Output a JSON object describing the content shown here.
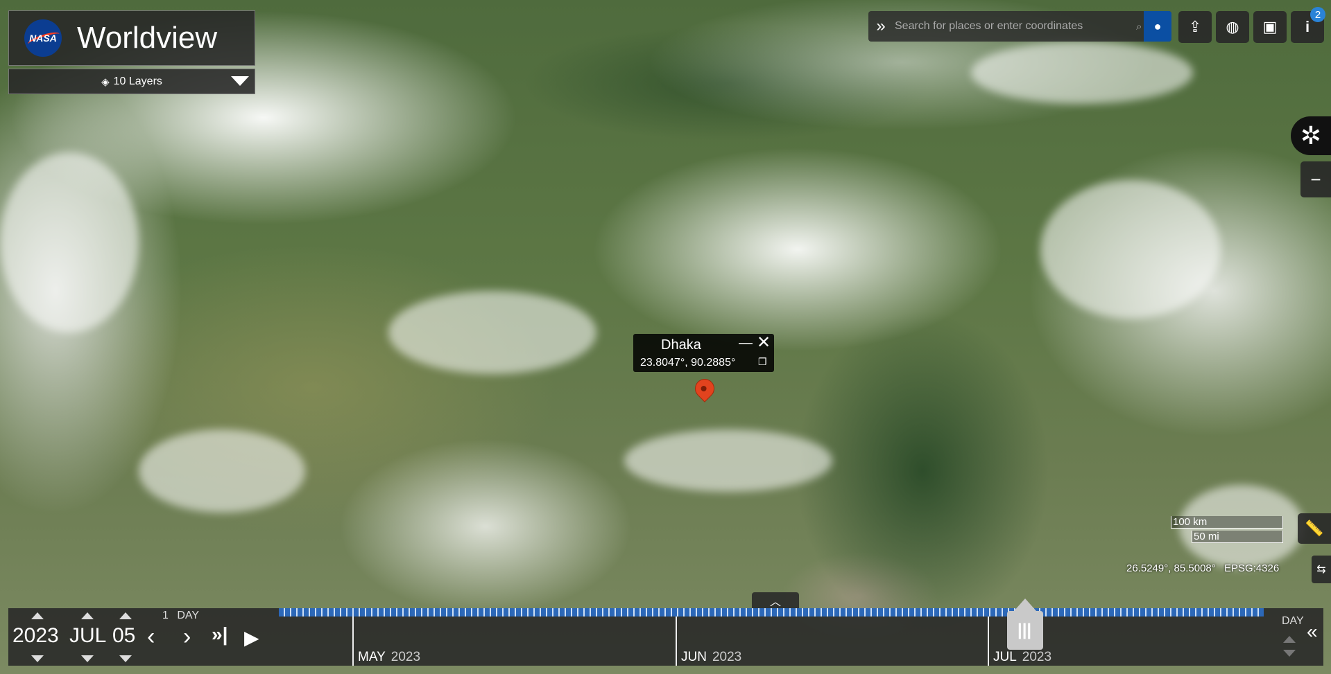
{
  "app": {
    "brand_mark": "NASA",
    "title": "Worldview",
    "layers_label": "10 Layers"
  },
  "search": {
    "placeholder": "Search for places or enter coordinates"
  },
  "toolbar": {
    "notification_count": "2",
    "icons": [
      "expand-icon",
      "search-icon",
      "location-pin-icon",
      "share-icon",
      "projection-icon",
      "camera-icon",
      "info-icon"
    ]
  },
  "popup": {
    "name": "Dhaka",
    "coordinates": "23.8047°, 90.2885°",
    "minimize": "—",
    "close": "✕"
  },
  "scale": {
    "km": "100 km",
    "mi": "50 mi"
  },
  "coordinate_readout": {
    "value": "26.5249°, 85.5008°",
    "projection": "EPSG:4326"
  },
  "timeline": {
    "year": "2023",
    "month": "JUL",
    "day": "05",
    "interval_count": "1",
    "interval_unit": "DAY",
    "zoom_label": "DAY",
    "months": [
      {
        "name": "MAY",
        "year": "2023"
      },
      {
        "name": "JUN",
        "year": "2023"
      },
      {
        "name": "JUL",
        "year": "2023"
      }
    ]
  },
  "colors": {
    "accent": "#2c68b8",
    "panel": "#282828",
    "pin": "#e2431e"
  }
}
